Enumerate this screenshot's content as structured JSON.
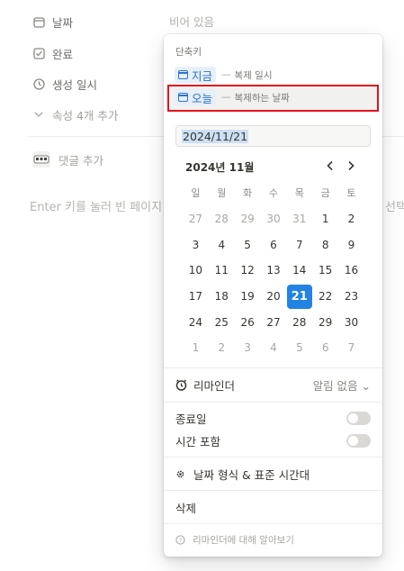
{
  "properties": {
    "date_label": "날짜",
    "date_value": "비어 있음",
    "done_label": "완료",
    "created_label": "생성 일시",
    "more_props": "속성 4개 추가",
    "add_comment": "댓글 추가",
    "enter_hint": "Enter 키를 눌러 빈 페이지",
    "hint_right": "선택"
  },
  "popover": {
    "section_title": "단축키",
    "shortcuts": [
      {
        "chip": "지금",
        "dash": "—",
        "desc": "복제 일시"
      },
      {
        "chip": "오늘",
        "dash": "—",
        "desc": "복제하는 날짜"
      }
    ],
    "date_input": "2024/11/21",
    "month_label": "2024년 11월",
    "prev_symbol": "‹",
    "next_symbol": "›",
    "weekdays": [
      "일",
      "월",
      "화",
      "수",
      "목",
      "금",
      "토"
    ],
    "weeks": [
      [
        "27",
        "28",
        "29",
        "30",
        "31",
        "1",
        "2"
      ],
      [
        "3",
        "4",
        "5",
        "6",
        "7",
        "8",
        "9"
      ],
      [
        "10",
        "11",
        "12",
        "13",
        "14",
        "15",
        "16"
      ],
      [
        "17",
        "18",
        "19",
        "20",
        "21",
        "22",
        "23"
      ],
      [
        "24",
        "25",
        "26",
        "27",
        "28",
        "29",
        "30"
      ],
      [
        "1",
        "2",
        "3",
        "4",
        "5",
        "6",
        "7"
      ]
    ],
    "selected_day": "21",
    "reminder_label": "리마인더",
    "reminder_value": "알림 없음 ⌄",
    "end_date_label": "종료일",
    "include_time_label": "시간 포함",
    "format_label": "날짜 형식 & 표준 시간대",
    "delete_label": "삭제",
    "learn_more": "리마인더에 대해 알아보기"
  },
  "colors": {
    "accent": "#2383e2",
    "highlight_border": "#e0141c",
    "chip_bg": "#e6f0fb"
  }
}
